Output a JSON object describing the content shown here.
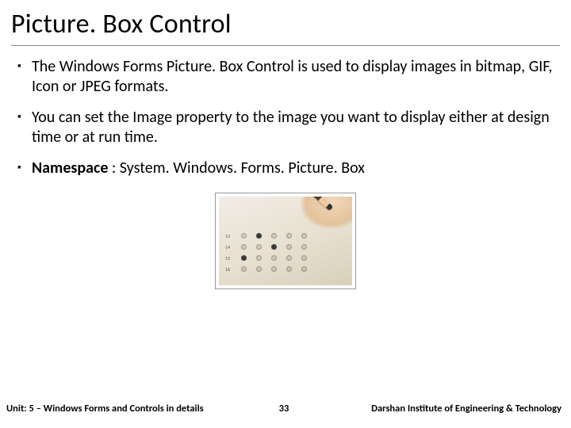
{
  "title": "Picture. Box Control",
  "bullets": [
    {
      "text": "The Windows Forms Picture. Box Control is used to display images in bitmap, GIF, Icon or JPEG formats.",
      "boldPrefix": null
    },
    {
      "text": "You can set the Image property to the image you want to display either at design time or at run time.",
      "boldPrefix": null
    },
    {
      "text": " : System. Windows. Forms. Picture. Box",
      "boldPrefix": "Namespace"
    }
  ],
  "footer": {
    "left": "Unit: 5 – Windows Forms and Controls in details",
    "center": "33",
    "right": "Darshan Institute of Engineering & Technology"
  }
}
